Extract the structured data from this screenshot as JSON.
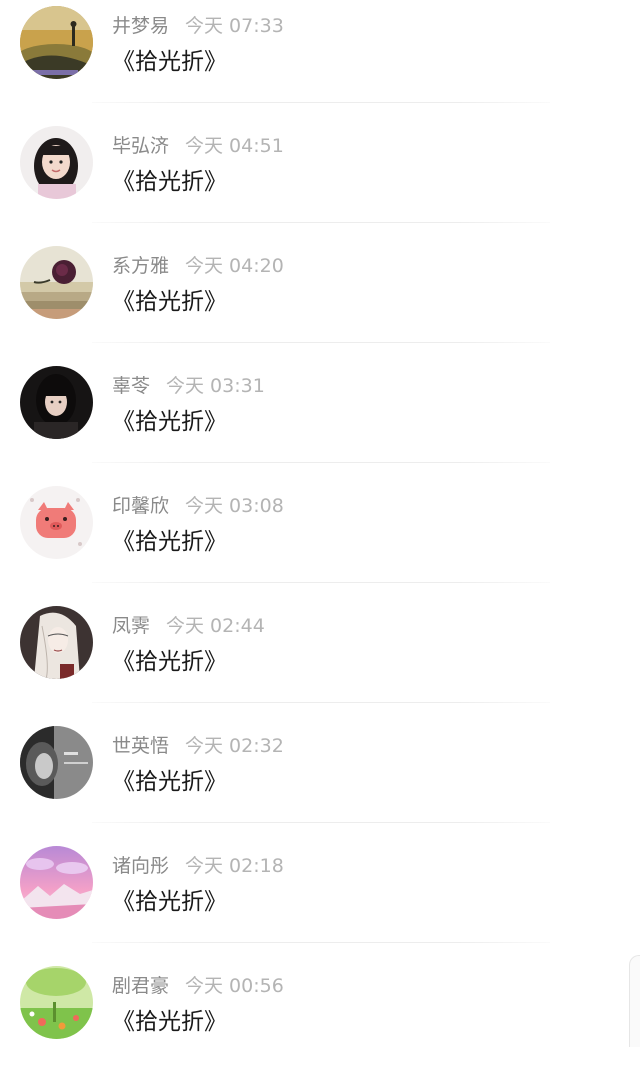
{
  "comments": [
    {
      "name": "井梦易",
      "time": "今天 07:33",
      "message": "《拾光折》",
      "avatar_icon": "landscape-avatar-icon"
    },
    {
      "name": "毕弘济",
      "time": "今天 04:51",
      "message": "《拾光折》",
      "avatar_icon": "girl-portrait-avatar-icon"
    },
    {
      "name": "系方雅",
      "time": "今天 04:20",
      "message": "《拾光折》",
      "avatar_icon": "rose-on-books-avatar-icon"
    },
    {
      "name": "辜苓",
      "time": "今天 03:31",
      "message": "《拾光折》",
      "avatar_icon": "dark-portrait-avatar-icon"
    },
    {
      "name": "印馨欣",
      "time": "今天 03:08",
      "message": "《拾光折》",
      "avatar_icon": "pink-pig-avatar-icon"
    },
    {
      "name": "凤霁",
      "time": "今天 02:44",
      "message": "《拾光折》",
      "avatar_icon": "anime-drawing-avatar-icon"
    },
    {
      "name": "世英悟",
      "time": "今天 02:32",
      "message": "《拾光折》",
      "avatar_icon": "bw-portrait-avatar-icon"
    },
    {
      "name": "诸向彤",
      "time": "今天 02:18",
      "message": "《拾光折》",
      "avatar_icon": "pink-sky-mountain-avatar-icon"
    },
    {
      "name": "剧君豪",
      "time": "今天 00:56",
      "message": "《拾光折》",
      "avatar_icon": "green-meadow-avatar-icon"
    }
  ]
}
